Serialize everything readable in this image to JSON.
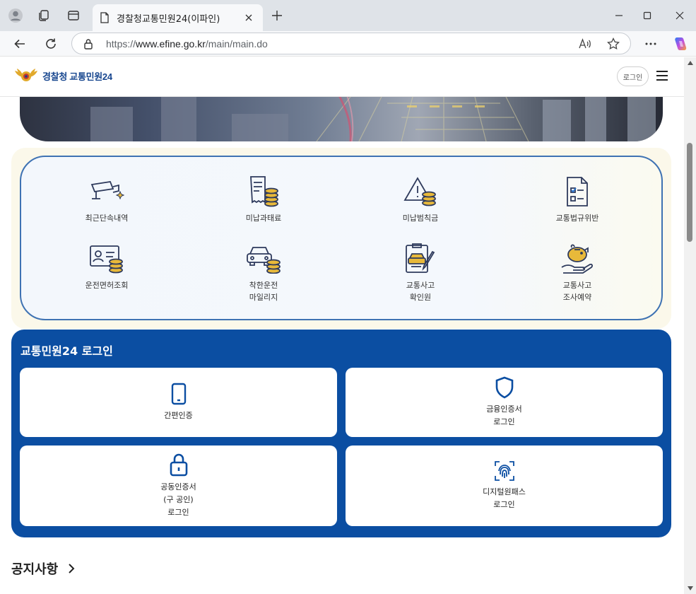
{
  "browser": {
    "tab_title": "경찰청교통민원24(이파인)",
    "url_prefix": "https://",
    "url_domain": "www.efine.go.kr",
    "url_path": "/main/main.do"
  },
  "header": {
    "logo_text": "경찰청 교통민원24",
    "login_label": "로그인"
  },
  "menu": {
    "items": [
      {
        "label": "최근단속내역",
        "icon": "camera-icon"
      },
      {
        "label": "미납과태료",
        "icon": "receipt-coins-icon"
      },
      {
        "label": "미납범칙금",
        "icon": "warning-coins-icon"
      },
      {
        "label": "교통법규위반",
        "icon": "checklist-icon"
      },
      {
        "label": "운전면허조회",
        "icon": "id-card-coins-icon"
      },
      {
        "label": "착한운전\n마일리지",
        "icon": "car-coins-icon"
      },
      {
        "label": "교통사고\n확인원",
        "icon": "accident-report-icon"
      },
      {
        "label": "교통사고\n조사예약",
        "icon": "piggy-bank-icon"
      }
    ]
  },
  "login": {
    "title": "교통민원24 로그인",
    "simple": "간편인증",
    "financial": "금융인증서\n로그인",
    "joint": "공동인증서\n(구 공인)\n로그인",
    "digital": "디지털원패스\n로그인"
  },
  "notice": {
    "title": "공지사항"
  },
  "colors": {
    "brand_blue": "#0b4ea2",
    "menu_border": "#3e72b3",
    "coin_gold": "#e8b93a",
    "icon_navy": "#2e3a5c"
  }
}
